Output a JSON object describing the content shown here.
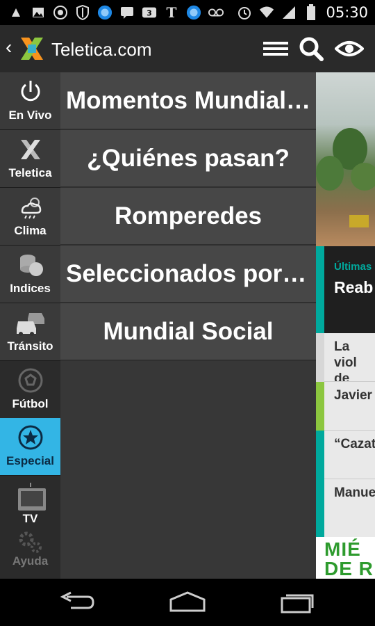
{
  "status_bar": {
    "time": "05:30",
    "icons": [
      "usb-debug-icon",
      "gallery-icon",
      "whatsapp-icon",
      "shield-icon",
      "weather-app-icon",
      "chat-icon",
      "3g-app-icon",
      "nyt-icon",
      "weather-app-icon",
      "voicemail-icon",
      "alarm-icon",
      "wifi-icon",
      "signal-icon",
      "battery-icon"
    ]
  },
  "action_bar": {
    "title": "Teletica.com",
    "back_glyph": "‹",
    "icons": [
      "menu-icon",
      "search-icon",
      "eye-icon"
    ]
  },
  "sidebar": {
    "items": [
      {
        "label": "En Vivo",
        "icon": "power-icon"
      },
      {
        "label": "Teletica",
        "icon": "teletica-x-icon"
      },
      {
        "label": "Clima",
        "icon": "weather-icon"
      },
      {
        "label": "Indices",
        "icon": "coins-icon"
      },
      {
        "label": "Tránsito",
        "icon": "cars-icon"
      },
      {
        "label": "Fútbol",
        "icon": "soccer-ball-icon"
      },
      {
        "label": "Especial",
        "icon": "star-circle-icon",
        "active": true
      },
      {
        "label": "TV",
        "icon": "tv-icon"
      },
      {
        "label": "Ayuda",
        "icon": "gears-icon"
      }
    ]
  },
  "submenu": {
    "items": [
      {
        "label": "Momentos Mundialistas"
      },
      {
        "label": "¿Quiénes pasan?"
      },
      {
        "label": "Romperedes"
      },
      {
        "label": "Seleccionados por Teletica"
      },
      {
        "label": "Mundial Social"
      }
    ]
  },
  "peek": {
    "section_label": "Últimas",
    "headline": "Reab",
    "news": [
      "La viol de asil",
      "Javier Barcel",
      "“Cazat",
      "Manue escéni"
    ],
    "banner_line1": "MIÉ",
    "banner_line2": "DE R"
  },
  "colors": {
    "accent": "#33b5e5",
    "teal_strip": "#00a99d",
    "green_strip": "#8cc63f",
    "banner_green": "#2e9b2e"
  },
  "nav_bar": {
    "buttons": [
      "back-icon",
      "home-icon",
      "recents-icon"
    ]
  }
}
